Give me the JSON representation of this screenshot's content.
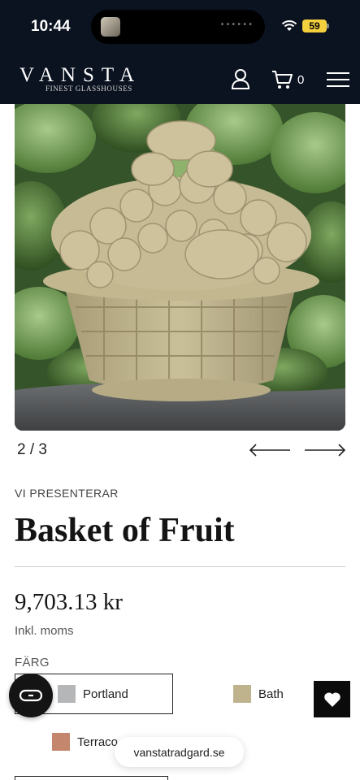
{
  "status_bar": {
    "time": "10:44",
    "battery": "59"
  },
  "header": {
    "brand": "VANSTA",
    "tagline": "FINEST GLASSHOUSES",
    "cart_count": "0"
  },
  "gallery": {
    "current": "2",
    "separator": "/",
    "total": "3",
    "counter_text": "2 / 3"
  },
  "product": {
    "eyebrow": "VI PRESENTERAR",
    "title": "Basket of Fruit",
    "price": "9,703.13 kr",
    "vat_note": "Inkl. moms",
    "color_label": "FÄRG",
    "colors": [
      {
        "name": "Portland",
        "hex": "#b5b6b8",
        "selected": true
      },
      {
        "name": "Bath",
        "hex": "#bfb38e",
        "selected": false
      },
      {
        "name": "Terracotta",
        "hex": "#c4866c",
        "selected": false
      }
    ],
    "terracotta_visible_label": "Terraco"
  },
  "browser": {
    "url": "vanstatradgard.se"
  },
  "colors": {
    "header_bg": "#0b1220",
    "stone": "#bfb48e"
  }
}
